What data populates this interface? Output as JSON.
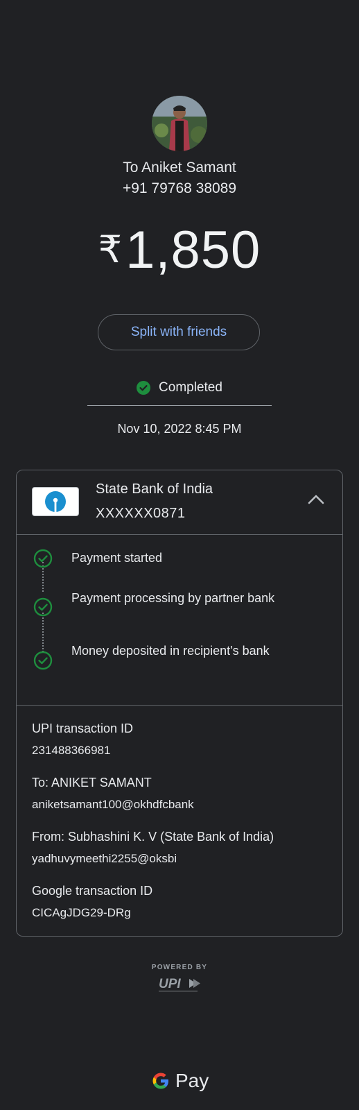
{
  "recipient": {
    "name_line": "To Aniket Samant",
    "phone": "+91 79768 38089"
  },
  "amount": {
    "currency_symbol": "₹",
    "value": "1,850"
  },
  "split_button_label": "Split with friends",
  "status": {
    "label": "Completed",
    "color": "#1e8e3e"
  },
  "datetime": "Nov 10, 2022 8:45 PM",
  "bank": {
    "name": "State Bank of India",
    "account": "XXXXXX0871",
    "logo_icon": "sbi-logo-icon",
    "logo_color": "#1a8fcf",
    "expand_icon": "chevron-up-icon"
  },
  "steps": [
    {
      "label": "Payment started"
    },
    {
      "label": "Payment processing by partner bank"
    },
    {
      "label": "Money deposited in recipient's bank"
    }
  ],
  "details": {
    "upi_label": "UPI transaction ID",
    "upi_value": "231488366981",
    "to_label": "To: ANIKET SAMANT",
    "to_value": "aniketsamant100@okhdfcbank",
    "from_label": "From: Subhashini K. V (State Bank of India)",
    "from_value": "yadhuvymeethi2255@oksbi",
    "google_label": "Google transaction ID",
    "google_value": "CICAgJDG29-DRg"
  },
  "footer": {
    "powered_by": "POWERED BY",
    "upi_logo_text": "UPI",
    "gpay_text": "Pay"
  },
  "colors": {
    "background": "#202124",
    "accent_blue": "#8ab4f8",
    "success_green": "#1e8e3e"
  }
}
